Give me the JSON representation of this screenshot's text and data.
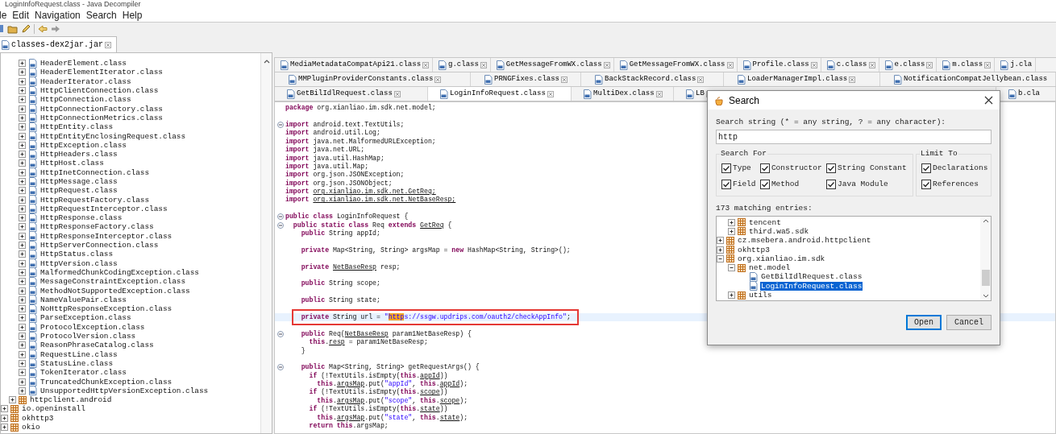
{
  "window": {
    "title": "LoginInfoRequest.class - Java Decompiler"
  },
  "menu": [
    "le",
    "Edit",
    "Navigation",
    "Search",
    "Help"
  ],
  "left_tab": {
    "label": "classes-dex2jar.jar"
  },
  "tree": [
    {
      "children": [
        {
          "children": [
            {
              "label": "HeaderElement.class",
              "kind": "class",
              "expanded": false
            },
            {
              "label": "HeaderElementIterator.class",
              "kind": "class",
              "expanded": false
            },
            {
              "label": "HeaderIterator.class",
              "kind": "class",
              "expanded": false
            },
            {
              "label": "HttpClientConnection.class",
              "kind": "class",
              "expanded": false
            },
            {
              "label": "HttpConnection.class",
              "kind": "class",
              "expanded": false
            },
            {
              "label": "HttpConnectionFactory.class",
              "kind": "class",
              "expanded": false
            },
            {
              "label": "HttpConnectionMetrics.class",
              "kind": "class",
              "expanded": false
            },
            {
              "label": "HttpEntity.class",
              "kind": "class",
              "expanded": false
            },
            {
              "label": "HttpEntityEnclosingRequest.class",
              "kind": "class",
              "expanded": false
            },
            {
              "label": "HttpException.class",
              "kind": "class",
              "expanded": false
            },
            {
              "label": "HttpHeaders.class",
              "kind": "class",
              "expanded": false
            },
            {
              "label": "HttpHost.class",
              "kind": "class",
              "expanded": false
            },
            {
              "label": "HttpInetConnection.class",
              "kind": "class",
              "expanded": false
            },
            {
              "label": "HttpMessage.class",
              "kind": "class",
              "expanded": false
            },
            {
              "label": "HttpRequest.class",
              "kind": "class",
              "expanded": false
            },
            {
              "label": "HttpRequestFactory.class",
              "kind": "class",
              "expanded": false
            },
            {
              "label": "HttpRequestInterceptor.class",
              "kind": "class",
              "expanded": false
            },
            {
              "label": "HttpResponse.class",
              "kind": "class",
              "expanded": false
            },
            {
              "label": "HttpResponseFactory.class",
              "kind": "class",
              "expanded": false
            },
            {
              "label": "HttpResponseInterceptor.class",
              "kind": "class",
              "expanded": false
            },
            {
              "label": "HttpServerConnection.class",
              "kind": "class",
              "expanded": false
            },
            {
              "label": "HttpStatus.class",
              "kind": "class",
              "expanded": false
            },
            {
              "label": "HttpVersion.class",
              "kind": "class",
              "expanded": false
            },
            {
              "label": "MalformedChunkCodingException.class",
              "kind": "class",
              "expanded": false
            },
            {
              "label": "MessageConstraintException.class",
              "kind": "class",
              "expanded": false
            },
            {
              "label": "MethodNotSupportedException.class",
              "kind": "class",
              "expanded": false
            },
            {
              "label": "NameValuePair.class",
              "kind": "class",
              "expanded": false
            },
            {
              "label": "NoHttpResponseException.class",
              "kind": "class",
              "expanded": false
            },
            {
              "label": "ParseException.class",
              "kind": "class",
              "expanded": false
            },
            {
              "label": "ProtocolException.class",
              "kind": "class",
              "expanded": false
            },
            {
              "label": "ProtocolVersion.class",
              "kind": "class",
              "expanded": false
            },
            {
              "label": "ReasonPhraseCatalog.class",
              "kind": "class",
              "expanded": false
            },
            {
              "label": "RequestLine.class",
              "kind": "class",
              "expanded": false
            },
            {
              "label": "StatusLine.class",
              "kind": "class",
              "expanded": false
            },
            {
              "label": "TokenIterator.class",
              "kind": "class",
              "expanded": false
            },
            {
              "label": "TruncatedChunkException.class",
              "kind": "class",
              "expanded": false
            },
            {
              "label": "UnsupportedHttpVersionException.class",
              "kind": "class",
              "expanded": false
            }
          ]
        },
        {
          "label": "httpclient.android",
          "kind": "package",
          "expanded": false
        }
      ]
    },
    {
      "label": "io.openinstall",
      "kind": "package",
      "expanded": false
    },
    {
      "label": "okhttp3",
      "kind": "package",
      "expanded": false
    },
    {
      "label": "okio",
      "kind": "package",
      "expanded": false
    }
  ],
  "editor_tabs": [
    {
      "tabs": [
        {
          "label": "MediaMetadataCompatApi21.class",
          "selected": false
        },
        {
          "label": "g.class",
          "selected": false
        },
        {
          "label": "GetMessageFromWX.class",
          "selected": false
        },
        {
          "label": "GetMessageFromWX.class",
          "selected": false
        },
        {
          "label": "Profile.class",
          "selected": false
        },
        {
          "label": "c.class",
          "selected": false
        },
        {
          "label": "e.class",
          "selected": false
        },
        {
          "label": "m.class",
          "selected": false
        },
        {
          "label": "j.cla",
          "selected": false
        }
      ]
    },
    {
      "tabs": [
        {
          "label": "MMPluginProviderConstants.class",
          "selected": false
        },
        {
          "label": "PRNGFixes.class",
          "selected": false
        },
        {
          "label": "BackStackRecord.class",
          "selected": false
        },
        {
          "label": "LoaderManagerImpl.class",
          "selected": false
        },
        {
          "label": "NotificationCompatJellybean.class",
          "selected": false
        }
      ]
    },
    {
      "tabs": [
        {
          "label": "GetBilIdlRequest.class",
          "selected": false
        },
        {
          "label": "LoginInfoRequest.class",
          "selected": true
        },
        {
          "label": "MultiDex.class",
          "selected": false
        },
        {
          "label": "LB",
          "selected": false
        },
        {
          "label": "b.cla",
          "selected": false
        }
      ]
    }
  ],
  "code": [
    {
      "foldable": false,
      "segments": [
        {
          "text": "package",
          "kind": "keyword"
        },
        {
          "text": " org.xianliao.im.sdk.net.model;",
          "kind": "plain"
        }
      ]
    },
    {
      "foldable": false
    },
    {
      "foldable": true,
      "segments": [
        {
          "text": "import",
          "kind": "keyword"
        },
        {
          "text": " android.text.TextUtils;",
          "kind": "plain"
        }
      ]
    },
    {
      "foldable": false,
      "segments": [
        {
          "text": "import",
          "kind": "keyword"
        },
        {
          "text": " android.util.Log;",
          "kind": "plain"
        }
      ]
    },
    {
      "foldable": false,
      "segments": [
        {
          "text": "import",
          "kind": "keyword"
        },
        {
          "text": " java.net.MalformedURLException;",
          "kind": "plain"
        }
      ]
    },
    {
      "foldable": false,
      "segments": [
        {
          "text": "import",
          "kind": "keyword"
        },
        {
          "text": " java.net.URL;",
          "kind": "plain"
        }
      ]
    },
    {
      "foldable": false,
      "segments": [
        {
          "text": "import",
          "kind": "keyword"
        },
        {
          "text": " java.util.HashMap;",
          "kind": "plain"
        }
      ]
    },
    {
      "foldable": false,
      "segments": [
        {
          "text": "import",
          "kind": "keyword"
        },
        {
          "text": " java.util.Map;",
          "kind": "plain"
        }
      ]
    },
    {
      "foldable": false,
      "segments": [
        {
          "text": "import",
          "kind": "keyword"
        },
        {
          "text": " org.json.JSONException;",
          "kind": "plain"
        }
      ]
    },
    {
      "foldable": false,
      "segments": [
        {
          "text": "import",
          "kind": "keyword"
        },
        {
          "text": " org.json.JSONObject;",
          "kind": "plain"
        }
      ]
    },
    {
      "foldable": false,
      "segments": [
        {
          "text": "import ",
          "kind": "keyword"
        },
        {
          "text": "org.xianliao.im.sdk.net.GetReq;",
          "kind": "link"
        }
      ]
    },
    {
      "foldable": false,
      "segments": [
        {
          "text": "import ",
          "kind": "keyword"
        },
        {
          "text": "org.xianliao.im.sdk.net.NetBaseResp;",
          "kind": "link"
        }
      ]
    },
    {
      "foldable": false
    },
    {
      "foldable": true,
      "segments": [
        {
          "text": "public class",
          "kind": "keyword"
        },
        {
          "text": " LoginInfoRequest {",
          "kind": "plain"
        }
      ]
    },
    {
      "foldable": true,
      "segments": [
        {
          "text": "  public static class",
          "kind": "keyword"
        },
        {
          "text": " Req ",
          "kind": "plain"
        },
        {
          "text": "extends ",
          "kind": "keyword"
        },
        {
          "text": "GetReq",
          "kind": "link"
        },
        {
          "text": " {",
          "kind": "plain"
        }
      ]
    },
    {
      "foldable": false,
      "segments": [
        {
          "text": "    public",
          "kind": "keyword"
        },
        {
          "text": " String appId;",
          "kind": "plain"
        }
      ]
    },
    {
      "foldable": false
    },
    {
      "foldable": false,
      "segments": [
        {
          "text": "    private",
          "kind": "keyword"
        },
        {
          "text": " Map<String, String> argsMap = ",
          "kind": "plain"
        },
        {
          "text": "new",
          "kind": "keyword"
        },
        {
          "text": " HashMap<String, String>();",
          "kind": "plain"
        }
      ]
    },
    {
      "foldable": false
    },
    {
      "foldable": false,
      "segments": [
        {
          "text": "    private ",
          "kind": "keyword"
        },
        {
          "text": "NetBaseResp",
          "kind": "link"
        },
        {
          "text": " resp;",
          "kind": "plain"
        }
      ]
    },
    {
      "foldable": false
    },
    {
      "foldable": false,
      "segments": [
        {
          "text": "    public",
          "kind": "keyword"
        },
        {
          "text": " String scope;",
          "kind": "plain"
        }
      ]
    },
    {
      "foldable": false
    },
    {
      "foldable": false,
      "segments": [
        {
          "text": "    public",
          "kind": "keyword"
        },
        {
          "text": " String state;",
          "kind": "plain"
        }
      ]
    },
    {
      "foldable": false
    },
    {
      "foldable": false,
      "current_line": true,
      "boxed": true,
      "segments": [
        {
          "text": "    private",
          "kind": "keyword"
        },
        {
          "text": " String url = ",
          "kind": "plain"
        },
        {
          "text": "\"",
          "kind": "string"
        },
        {
          "text": "http",
          "kind": "match"
        },
        {
          "text": "s://ssgw.updrips.com/oauth2/checkAppInfo\"",
          "kind": "string"
        },
        {
          "text": ";",
          "kind": "plain"
        }
      ]
    },
    {
      "foldable": false
    },
    {
      "foldable": true,
      "segments": [
        {
          "text": "    public",
          "kind": "keyword"
        },
        {
          "text": " Req(",
          "kind": "plain"
        },
        {
          "text": "NetBaseResp",
          "kind": "link"
        },
        {
          "text": " param1NetBaseResp) {",
          "kind": "plain"
        }
      ]
    },
    {
      "foldable": false,
      "segments": [
        {
          "text": "      this",
          "kind": "keyword"
        },
        {
          "text": ".",
          "kind": "plain"
        },
        {
          "text": "resp",
          "kind": "link"
        },
        {
          "text": " = param1NetBaseResp;",
          "kind": "plain"
        }
      ]
    },
    {
      "foldable": false,
      "segments": [
        {
          "text": "    }",
          "kind": "plain"
        }
      ]
    },
    {
      "foldable": false
    },
    {
      "foldable": true,
      "segments": [
        {
          "text": "    public",
          "kind": "keyword"
        },
        {
          "text": " Map<String, String> getRequestArgs() {",
          "kind": "plain"
        }
      ]
    },
    {
      "foldable": false,
      "segments": [
        {
          "text": "      if",
          "kind": "keyword"
        },
        {
          "text": " (!TextUtils.isEmpty(",
          "kind": "plain"
        },
        {
          "text": "this",
          "kind": "keyword"
        },
        {
          "text": ".",
          "kind": "plain"
        },
        {
          "text": "appId",
          "kind": "link"
        },
        {
          "text": "))",
          "kind": "plain"
        }
      ]
    },
    {
      "foldable": false,
      "segments": [
        {
          "text": "        this",
          "kind": "keyword"
        },
        {
          "text": ".",
          "kind": "plain"
        },
        {
          "text": "argsMap",
          "kind": "link"
        },
        {
          "text": ".put(",
          "kind": "plain"
        },
        {
          "text": "\"appId\"",
          "kind": "string"
        },
        {
          "text": ", ",
          "kind": "plain"
        },
        {
          "text": "this",
          "kind": "keyword"
        },
        {
          "text": ".",
          "kind": "plain"
        },
        {
          "text": "appId",
          "kind": "link"
        },
        {
          "text": ");",
          "kind": "plain"
        }
      ]
    },
    {
      "foldable": false,
      "segments": [
        {
          "text": "      if",
          "kind": "keyword"
        },
        {
          "text": " (!TextUtils.isEmpty(",
          "kind": "plain"
        },
        {
          "text": "this",
          "kind": "keyword"
        },
        {
          "text": ".",
          "kind": "plain"
        },
        {
          "text": "scope",
          "kind": "link"
        },
        {
          "text": "))",
          "kind": "plain"
        }
      ]
    },
    {
      "foldable": false,
      "segments": [
        {
          "text": "        this",
          "kind": "keyword"
        },
        {
          "text": ".",
          "kind": "plain"
        },
        {
          "text": "argsMap",
          "kind": "link"
        },
        {
          "text": ".put(",
          "kind": "plain"
        },
        {
          "text": "\"scope\"",
          "kind": "string"
        },
        {
          "text": ", ",
          "kind": "plain"
        },
        {
          "text": "this",
          "kind": "keyword"
        },
        {
          "text": ".",
          "kind": "plain"
        },
        {
          "text": "scope",
          "kind": "link"
        },
        {
          "text": ");",
          "kind": "plain"
        }
      ]
    },
    {
      "foldable": false,
      "segments": [
        {
          "text": "      if",
          "kind": "keyword"
        },
        {
          "text": " (!TextUtils.isEmpty(",
          "kind": "plain"
        },
        {
          "text": "this",
          "kind": "keyword"
        },
        {
          "text": ".",
          "kind": "plain"
        },
        {
          "text": "state",
          "kind": "link"
        },
        {
          "text": "))",
          "kind": "plain"
        }
      ]
    },
    {
      "foldable": false,
      "segments": [
        {
          "text": "        this",
          "kind": "keyword"
        },
        {
          "text": ".",
          "kind": "plain"
        },
        {
          "text": "argsMap",
          "kind": "link"
        },
        {
          "text": ".put(",
          "kind": "plain"
        },
        {
          "text": "\"state\"",
          "kind": "string"
        },
        {
          "text": ", ",
          "kind": "plain"
        },
        {
          "text": "this",
          "kind": "keyword"
        },
        {
          "text": ".",
          "kind": "plain"
        },
        {
          "text": "state",
          "kind": "link"
        },
        {
          "text": ");",
          "kind": "plain"
        }
      ]
    },
    {
      "foldable": false,
      "segments": [
        {
          "text": "      return this",
          "kind": "keyword"
        },
        {
          "text": ".argsMap;",
          "kind": "plain"
        }
      ]
    }
  ],
  "search_dialog": {
    "title": "Search",
    "label": "Search string (* = any string, ? = any character):",
    "search_string": "http",
    "search_for": {
      "title": "Search For",
      "options": [
        {
          "label": "Type",
          "checked": true
        },
        {
          "label": "Constructor",
          "checked": true
        },
        {
          "label": "String Constant",
          "checked": true
        },
        {
          "label": "Field",
          "checked": true
        },
        {
          "label": "Method",
          "checked": true
        },
        {
          "label": "Java Module",
          "checked": true
        }
      ]
    },
    "limit_to": {
      "title": "Limit To",
      "options": [
        {
          "label": "Declarations",
          "checked": true
        },
        {
          "label": "References",
          "checked": true
        }
      ]
    },
    "match_count": "173 matching entries:",
    "results": [
      {
        "children": [
          {
            "children": [
              {
                "label": "tencent",
                "kind": "package",
                "expanded": false
              },
              {
                "label": "third.wa5.sdk",
                "kind": "package",
                "expanded": false
              }
            ]
          },
          {
            "label": "cz.msebera.android.httpclient",
            "kind": "package",
            "expanded": false
          },
          {
            "label": "okhttp3",
            "kind": "package",
            "expanded": false
          },
          {
            "label": "org.xianliao.im.sdk",
            "kind": "package",
            "expanded": true,
            "children": [
              {
                "label": "net.model",
                "kind": "package",
                "expanded": true,
                "children": [
                  {
                    "label": "GetBilIdlRequest.class",
                    "kind": "class",
                    "selected": false
                  },
                  {
                    "label": "LoginInfoRequest.class",
                    "kind": "class",
                    "selected": true
                  }
                ]
              },
              {
                "label": "utils",
                "kind": "package",
                "expanded": false
              }
            ]
          }
        ]
      }
    ],
    "buttons": [
      {
        "label": "Open",
        "focused": true
      },
      {
        "label": "Cancel",
        "focused": false
      }
    ]
  }
}
